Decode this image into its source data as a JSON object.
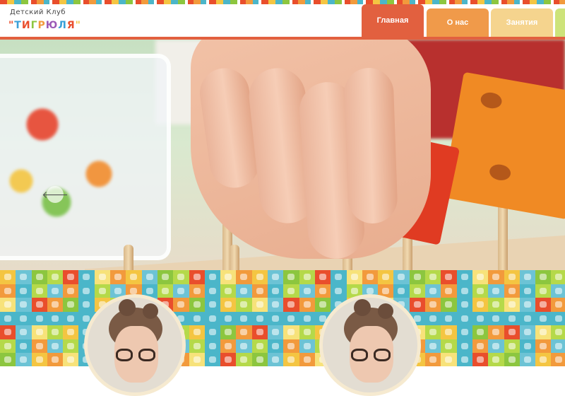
{
  "logo": {
    "top_text": "Детский Клуб",
    "main_text": "\"ТИГРЮЛЯ\"",
    "letters": [
      "\"",
      "Т",
      "И",
      "Г",
      "Р",
      "Ю",
      "Л",
      "Я",
      "\""
    ],
    "letter_colors": [
      "#e94e2c",
      "#3aa0d8",
      "#e94e2c",
      "#8cc63f",
      "#f29a3c",
      "#9b59b6",
      "#3aa0d8",
      "#e94e2c",
      "#f4c542"
    ]
  },
  "nav": {
    "items": [
      {
        "label": "Главная",
        "active": true
      },
      {
        "label": "О нас",
        "active": false
      },
      {
        "label": "Занятия",
        "active": false
      }
    ]
  },
  "hero": {
    "prev_icon": "arrow-left-icon",
    "prev_glyph": "🡐"
  },
  "colors": {
    "accent": "#e2603f",
    "tab_about": "#f09a4a",
    "tab_classes": "#f5d48e",
    "tile_palette": [
      "#f4c542",
      "#4bb6c9",
      "#8cc63f",
      "#f29a3c",
      "#e94e2c",
      "#6cc3d5",
      "#f7e27a",
      "#b5d94a"
    ]
  },
  "portraits": [
    {
      "name": "portrait-girl-1"
    },
    {
      "name": "portrait-girl-2"
    }
  ]
}
